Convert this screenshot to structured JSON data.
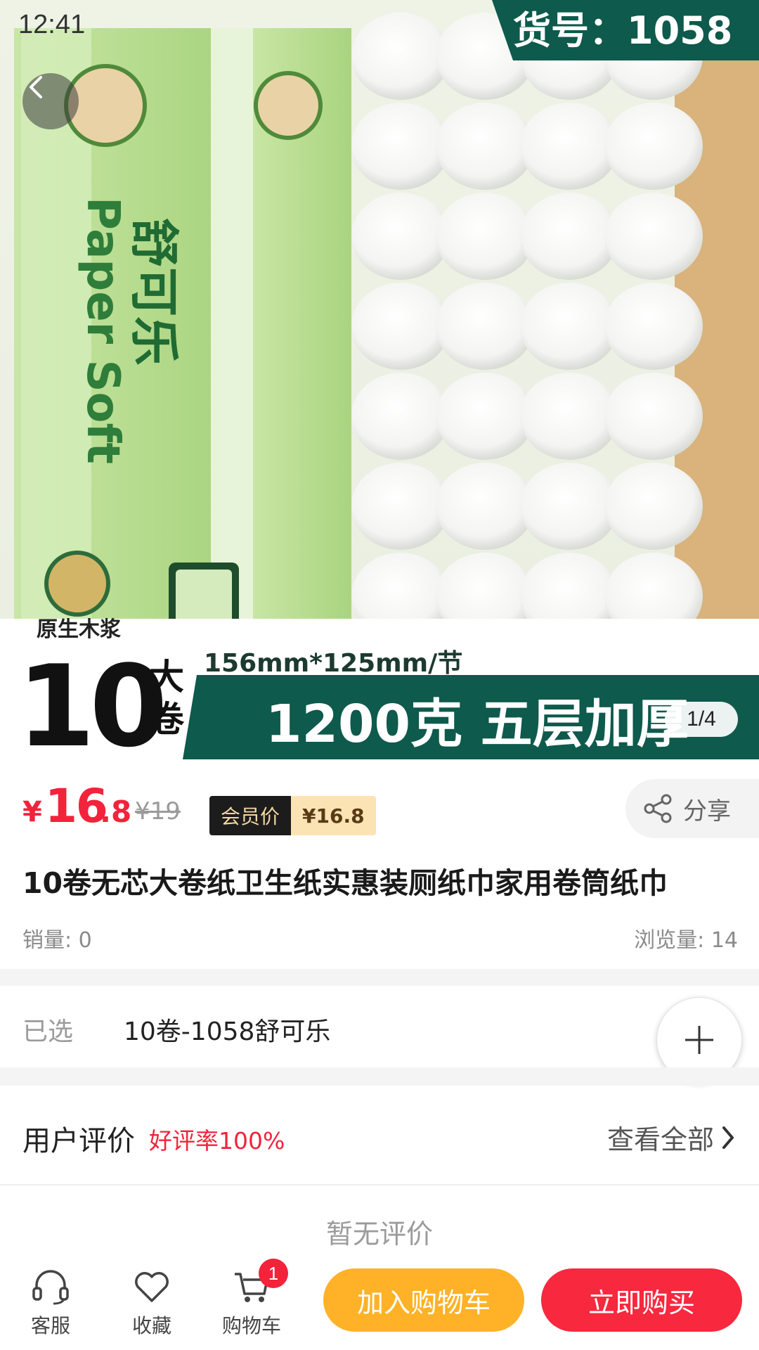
{
  "status_bar": {
    "time": "12:41"
  },
  "hero": {
    "item_code": "货号：1058",
    "brand_cn": "舒可乐",
    "brand_en": "Paper Soft",
    "badge": "原生木浆",
    "big_number": "10",
    "big_unit_1": "大",
    "big_unit_2": "卷",
    "size": "156mm*125mm/节",
    "banner": "1200克 五层加厚",
    "image_counter": "1/4"
  },
  "price": {
    "currency": "¥",
    "integer": "16",
    "decimal": ".8",
    "original": "¥19",
    "member_label": "会员价",
    "member_price": "¥16.8",
    "share_label": "分享"
  },
  "product": {
    "title": "10卷无芯大卷纸卫生纸实惠装厕纸巾家用卷筒纸巾",
    "sales": "销量: 0",
    "views": "浏览量: 14"
  },
  "selection": {
    "label": "已选",
    "value": "10卷-1058舒可乐"
  },
  "reviews": {
    "title": "用户评价",
    "rate": "好评率100%",
    "view_all": "查看全部",
    "empty": "暂无评价"
  },
  "bottom_bar": {
    "service": "客服",
    "favorite": "收藏",
    "cart": "购物车",
    "cart_count": "1",
    "add_to_cart": "加入购物车",
    "buy_now": "立即购买"
  },
  "colors": {
    "price_red": "#f2233b",
    "cart_orange": "#ffb227",
    "buy_red": "#f8283f",
    "package_green": "#b7dc8f",
    "banner_teal": "#0e5a4c"
  }
}
